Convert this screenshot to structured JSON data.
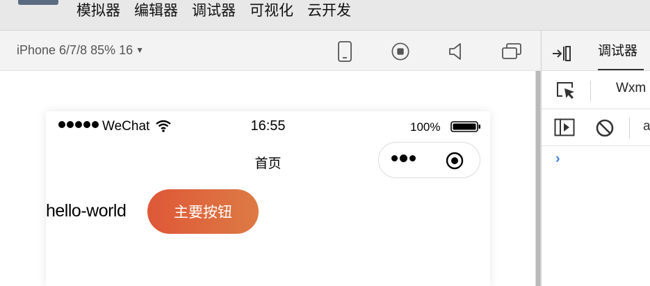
{
  "menu": {
    "items": [
      {
        "label": "模拟器"
      },
      {
        "label": "编辑器"
      },
      {
        "label": "调试器"
      },
      {
        "label": "可视化"
      },
      {
        "label": "云开发"
      }
    ]
  },
  "simulator_toolbar": {
    "device": "iPhone 6/7/8 85% 16",
    "buttons": [
      "phone-icon",
      "record-icon",
      "speaker-icon",
      "window-icon"
    ]
  },
  "phone": {
    "status_bar": {
      "carrier": "WeChat",
      "time": "16:55",
      "battery": "100%"
    },
    "navbar": {
      "title": "首页"
    },
    "content": {
      "hello_text": "hello-world",
      "primary_button": "主要按钮"
    },
    "button_colors": {
      "start": "#de5838",
      "end": "#dd7a44"
    }
  },
  "devtools": {
    "tab": "调试器",
    "panel_tab": "Wxm",
    "filter": "a",
    "prompt": "›",
    "icons": [
      "dock-right-icon",
      "inspect-icon",
      "show-sidebar-icon",
      "clear-console-icon"
    ]
  }
}
